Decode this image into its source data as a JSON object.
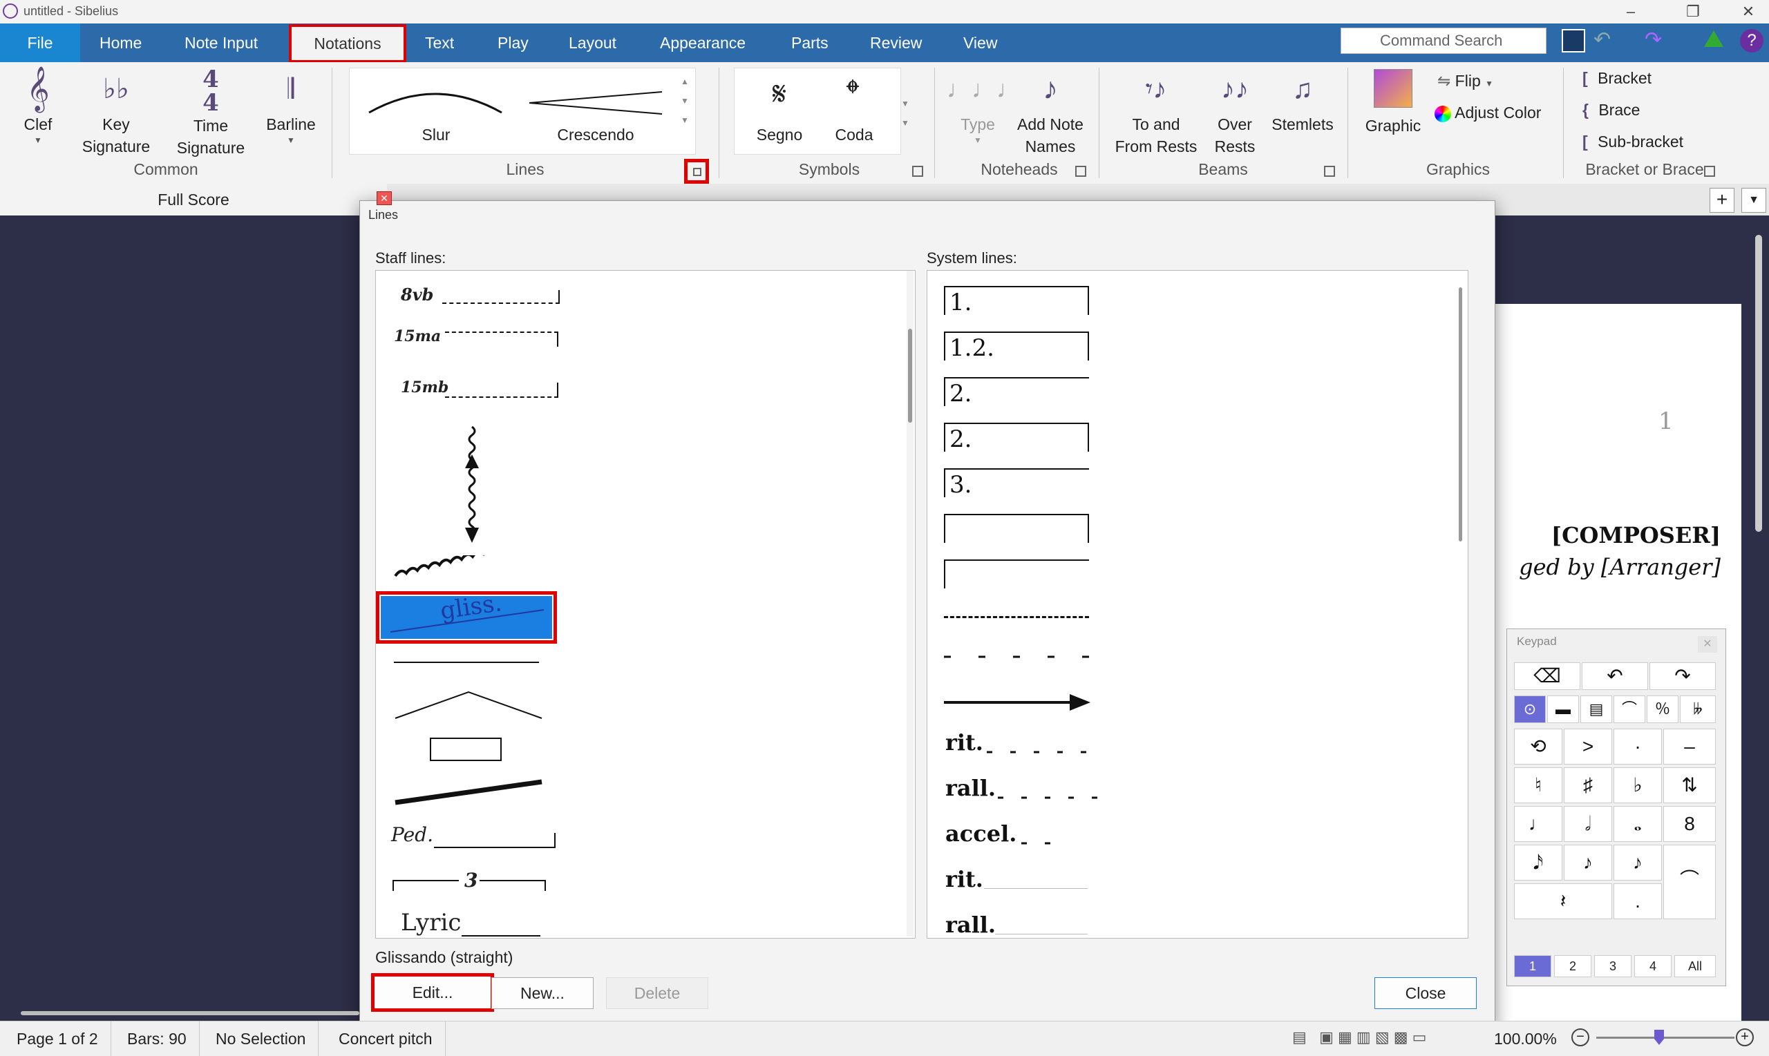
{
  "window": {
    "title": "untitled - Sibelius",
    "controls": [
      "–",
      "❐",
      "✕"
    ]
  },
  "menu": {
    "file": "File",
    "tabs": [
      "Home",
      "Note Input",
      "Notations",
      "Text",
      "Play",
      "Layout",
      "Appearance",
      "Parts",
      "Review",
      "View"
    ],
    "active_tab": "Notations",
    "search_placeholder": "Command Search"
  },
  "ribbon": {
    "common": {
      "label": "Common",
      "clef": "Clef",
      "key_signature": [
        "Key",
        "Signature"
      ],
      "time_signature": [
        "Time",
        "Signature"
      ],
      "barline": "Barline"
    },
    "lines": {
      "label": "Lines",
      "gallery": [
        "Slur",
        "Crescendo"
      ]
    },
    "symbols": {
      "label": "Symbols",
      "gallery": [
        "Segno",
        "Coda"
      ]
    },
    "noteheads": {
      "label": "Noteheads",
      "type": "Type",
      "add_note_names": [
        "Add Note",
        "Names"
      ]
    },
    "beams": {
      "label": "Beams",
      "to_and_from_rests": [
        "To and",
        "From Rests"
      ],
      "over_rests": [
        "Over",
        "Rests"
      ],
      "stemlets": "Stemlets"
    },
    "graphics": {
      "label": "Graphics",
      "graphic": "Graphic",
      "flip": "Flip",
      "adjust_color": "Adjust Color"
    },
    "bracket_or_brace": {
      "label": "Bracket or Brace",
      "bracket": "Bracket",
      "brace": "Brace",
      "sub_bracket": "Sub-bracket"
    }
  },
  "document": {
    "score_tab": "Full Score",
    "page_number": "1",
    "composer": "[COMPOSER]",
    "arranger": "ged by [Arranger]"
  },
  "dialog": {
    "title": "Lines",
    "staff_lines_label": "Staff lines:",
    "system_lines_label": "System lines:",
    "staff_lines": [
      "8vb",
      "15ma",
      "15mb",
      "",
      "",
      "gliss.",
      "",
      "",
      "",
      "",
      "Ped.",
      "3",
      "Lyric"
    ],
    "selected_staff_line": "gliss.",
    "system_lines": [
      "1.",
      "1.2.",
      "2.",
      "2.",
      "3.",
      "",
      "",
      "",
      "",
      "",
      "rit.",
      "rall.",
      "accel.",
      "rit.",
      "rall."
    ],
    "selected_name": "Glissando (straight)",
    "buttons": {
      "edit": "Edit...",
      "new": "New...",
      "delete": "Delete",
      "close": "Close"
    }
  },
  "keypad": {
    "title": "Keypad",
    "tabs": [
      "1",
      "2",
      "3",
      "4",
      "All"
    ],
    "active_tab": "1"
  },
  "status": {
    "page": "Page 1 of 2",
    "bars": "Bars: 90",
    "selection": "No Selection",
    "pitch": "Concert pitch",
    "zoom": "100.00%"
  },
  "colors": {
    "accent": "#2c6aaa",
    "file_tab": "#1a86d1",
    "highlight": "#e00000",
    "selection": "#1a7fe0",
    "doc_bg": "#2d2e47"
  }
}
